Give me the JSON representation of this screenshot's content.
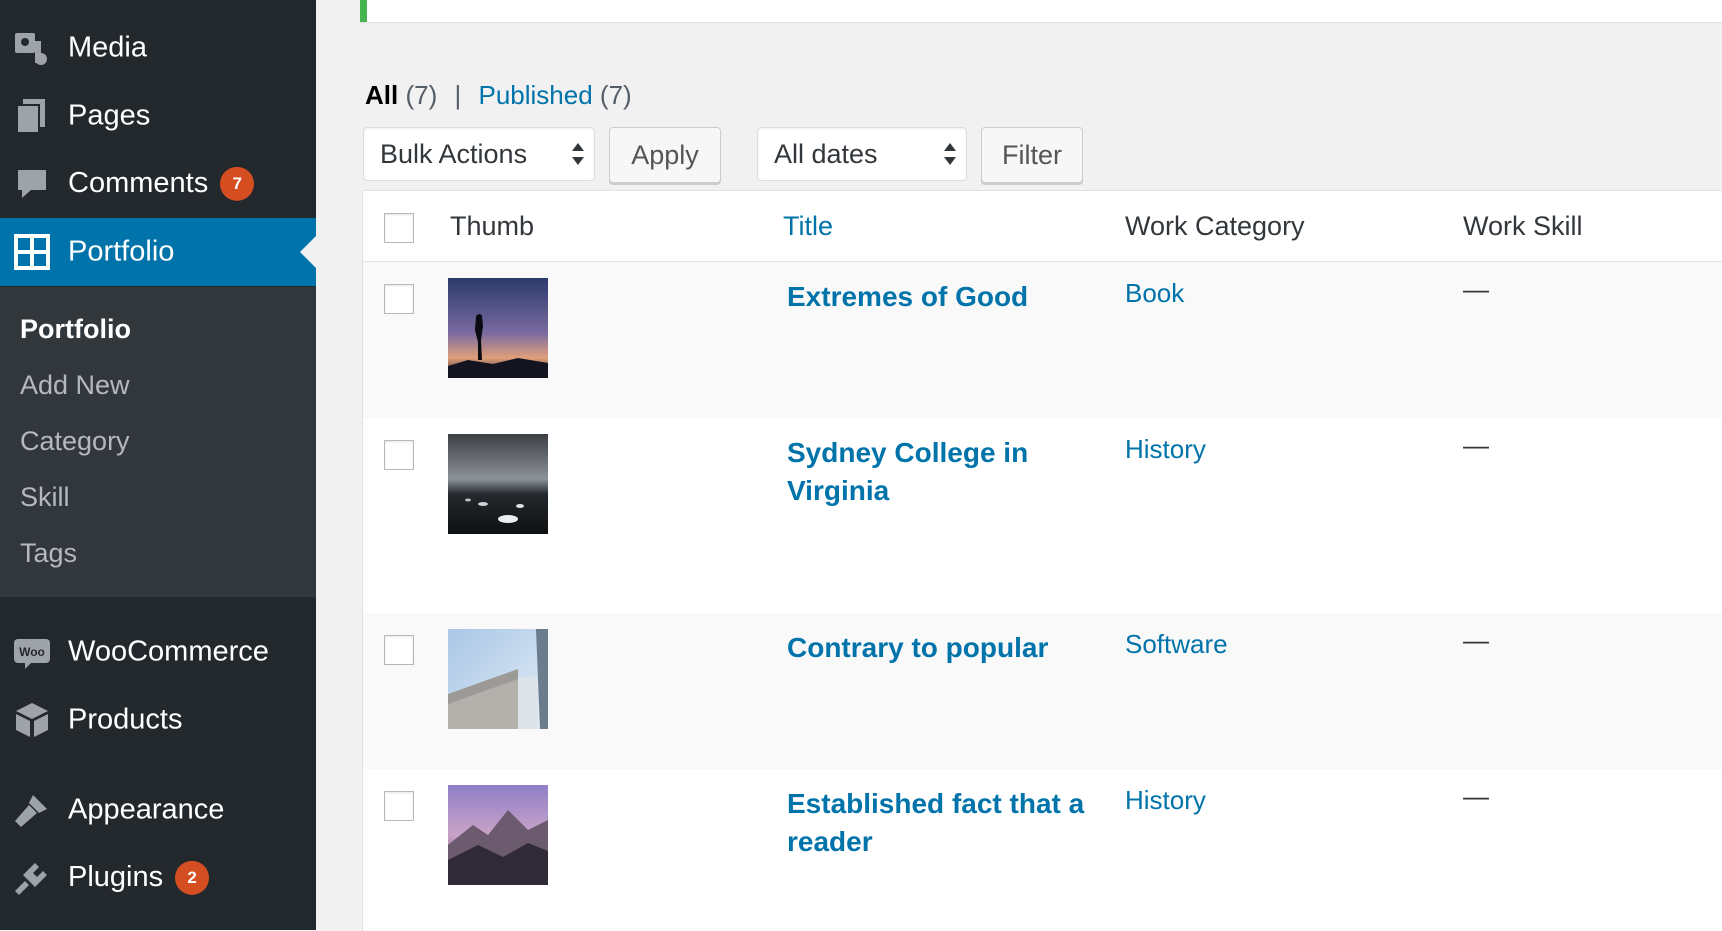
{
  "sidebar": {
    "menu": [
      {
        "label": "Media",
        "icon": "media-icon"
      },
      {
        "label": "Pages",
        "icon": "pages-icon"
      },
      {
        "label": "Comments",
        "icon": "comments-icon",
        "badge": "7"
      },
      {
        "label": "Portfolio",
        "icon": "portfolio-icon",
        "current": true
      },
      {
        "label": "WooCommerce",
        "icon": "woocommerce-icon"
      },
      {
        "label": "Products",
        "icon": "products-icon"
      },
      {
        "label": "Appearance",
        "icon": "appearance-icon"
      },
      {
        "label": "Plugins",
        "icon": "plugins-icon",
        "badge": "2"
      }
    ],
    "submenu": [
      "Portfolio",
      "Add New",
      "Category",
      "Skill",
      "Tags"
    ],
    "colors": {
      "bg": "#23282d",
      "submenu_bg": "#32373c",
      "current": "#0073aa",
      "badge": "#d54e21"
    }
  },
  "views": {
    "all_label": "All",
    "all_count": "(7)",
    "separator": "|",
    "published_label": "Published",
    "published_count": "(7)"
  },
  "actions": {
    "bulk_actions": "Bulk Actions",
    "apply": "Apply",
    "dates": "All dates",
    "filter": "Filter"
  },
  "table": {
    "columns": [
      "Thumb",
      "Title",
      "Work Category",
      "Work Skill"
    ],
    "rows": [
      {
        "title": "Extremes of Good",
        "category": "Book",
        "skill": "—",
        "thumb": "silhouette-sunset-photo"
      },
      {
        "title": "Sydney College in Virginia",
        "category": "History",
        "skill": "—",
        "thumb": "ice-beach-photo"
      },
      {
        "title": "Contrary to popular",
        "category": "Software",
        "skill": "—",
        "thumb": "building-sky-photo"
      },
      {
        "title": "Established fact that a reader",
        "category": "History",
        "skill": "—",
        "thumb": "mountain-range-photo"
      }
    ]
  },
  "accent": "#0073aa",
  "notice_color": "#46b450"
}
